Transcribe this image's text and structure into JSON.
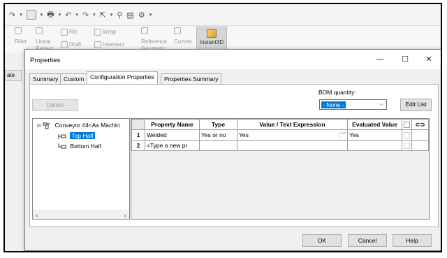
{
  "ribbon": {
    "items": [
      {
        "label": "Fillet"
      },
      {
        "label": "Linear\nPattern"
      },
      {
        "label": "Rib"
      },
      {
        "label": "Draft"
      },
      {
        "label": "Wrap"
      },
      {
        "label": "Intersect"
      },
      {
        "label": "Reference\nGeometry"
      },
      {
        "label": "Curves"
      },
      {
        "label": "Instant3D"
      }
    ],
    "left_tab": "ate"
  },
  "dialog": {
    "title": "Properties",
    "window_buttons": {
      "minimize": "—",
      "maximize": "☐",
      "close": "✕"
    },
    "tabs": [
      "Summary",
      "Custom",
      "Configuration Properties",
      "Properties Summary"
    ],
    "active_tab": "Configuration Properties",
    "delete_label": "Delete",
    "bom_label": "BOM quantity:",
    "bom_value": "- None -",
    "edit_list_label": "Edit List",
    "tree": {
      "root": "Conveyor #4<As Machin",
      "children": [
        "Top Half",
        "Bottom Half"
      ],
      "selected": "Top Half"
    },
    "grid": {
      "headers": [
        "Property Name",
        "Type",
        "Value / Text Expression",
        "Evaluated Value"
      ],
      "rows": [
        {
          "num": "1",
          "name": "Welded",
          "type": "Yes or no",
          "value": "Yes",
          "evaluated": "Yes"
        },
        {
          "num": "2",
          "name": "<Type a new pr",
          "type": "",
          "value": "",
          "evaluated": ""
        }
      ]
    },
    "ok_label": "OK",
    "cancel_label": "Cancel",
    "help_label": "Help"
  },
  "colors": {
    "selection": "#0078d7",
    "panel": "#f0f0f0"
  }
}
